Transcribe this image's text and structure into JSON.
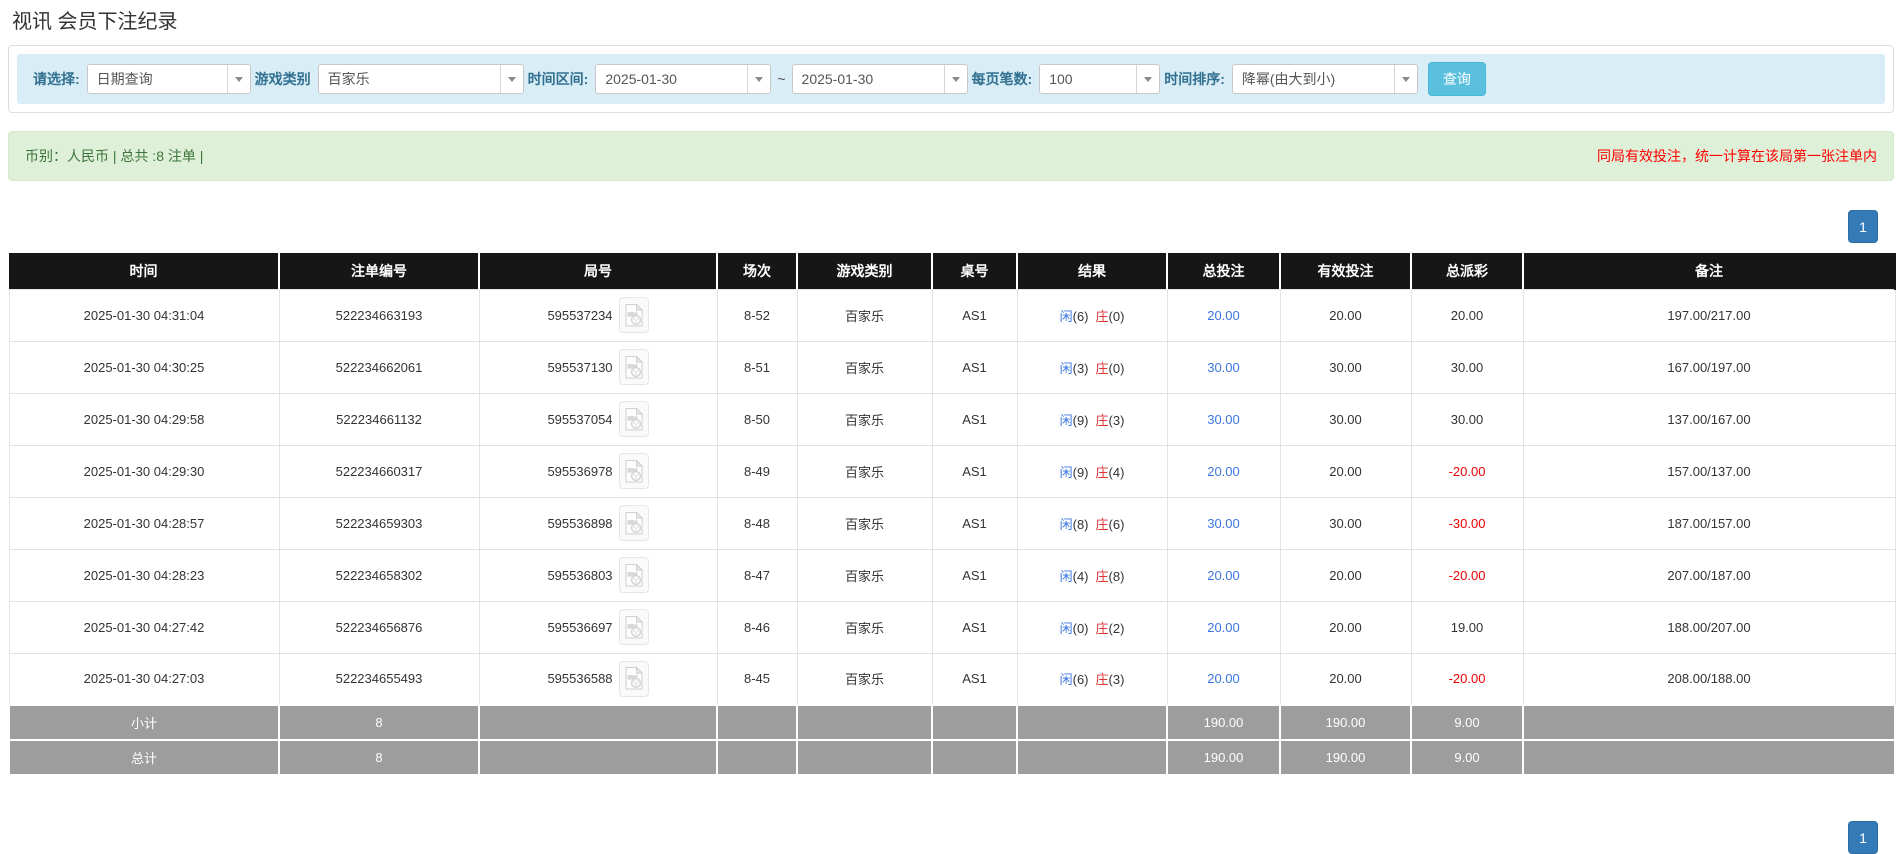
{
  "page": {
    "title": "视讯 会员下注纪录"
  },
  "filters": {
    "select_label": "请选择:",
    "select_value": "日期查询",
    "game_label": "游戏类别",
    "game_value": "百家乐",
    "range_label": "时间区间:",
    "date_from": "2025-01-30",
    "range_separator": "~",
    "date_to": "2025-01-30",
    "page_size_label": "每页笔数:",
    "page_size_value": "100",
    "sort_label": "时间排序:",
    "sort_value": "降幂(由大到小)",
    "query_button": "查询"
  },
  "summary": {
    "left": "币别：人民币 | 总共 :8 注单 |",
    "right": "同局有效投注，统一计算在该局第一张注单内"
  },
  "pagination": {
    "page": "1"
  },
  "colors": {
    "accent_blue": "#337ab7",
    "query_button": "#5bc0de",
    "filter_bg": "#d9edf7",
    "summary_bg": "#dff0d8",
    "header_bg": "#161616",
    "player_blue": "#3b76e0",
    "banker_red": "#e03333",
    "negative_red": "#f00000"
  },
  "icons": {
    "combo_caret": "caret-down-icon",
    "round_video": "video-replay-icon"
  },
  "table": {
    "headers": [
      "时间",
      "注单编号",
      "局号",
      "场次",
      "游戏类别",
      "桌号",
      "结果",
      "总投注",
      "有效投注",
      "总派彩",
      "备注"
    ],
    "rows": [
      {
        "time": "2025-01-30 04:31:04",
        "bet_id": "522234663193",
        "round_id": "595537234",
        "session": "8-52",
        "game": "百家乐",
        "table_no": "AS1",
        "p_label": "闲",
        "p_num": "(6)",
        "b_label": "庄",
        "b_num": "(0)",
        "total_bet": "20.00",
        "valid_bet": "20.00",
        "payout": "20.00",
        "remark": "197.00/217.00"
      },
      {
        "time": "2025-01-30 04:30:25",
        "bet_id": "522234662061",
        "round_id": "595537130",
        "session": "8-51",
        "game": "百家乐",
        "table_no": "AS1",
        "p_label": "闲",
        "p_num": "(3)",
        "b_label": "庄",
        "b_num": "(0)",
        "total_bet": "30.00",
        "valid_bet": "30.00",
        "payout": "30.00",
        "remark": "167.00/197.00"
      },
      {
        "time": "2025-01-30 04:29:58",
        "bet_id": "522234661132",
        "round_id": "595537054",
        "session": "8-50",
        "game": "百家乐",
        "table_no": "AS1",
        "p_label": "闲",
        "p_num": "(9)",
        "b_label": "庄",
        "b_num": "(3)",
        "total_bet": "30.00",
        "valid_bet": "30.00",
        "payout": "30.00",
        "remark": "137.00/167.00"
      },
      {
        "time": "2025-01-30 04:29:30",
        "bet_id": "522234660317",
        "round_id": "595536978",
        "session": "8-49",
        "game": "百家乐",
        "table_no": "AS1",
        "p_label": "闲",
        "p_num": "(9)",
        "b_label": "庄",
        "b_num": "(4)",
        "total_bet": "20.00",
        "valid_bet": "20.00",
        "payout": "-20.00",
        "remark": "157.00/137.00"
      },
      {
        "time": "2025-01-30 04:28:57",
        "bet_id": "522234659303",
        "round_id": "595536898",
        "session": "8-48",
        "game": "百家乐",
        "table_no": "AS1",
        "p_label": "闲",
        "p_num": "(8)",
        "b_label": "庄",
        "b_num": "(6)",
        "total_bet": "30.00",
        "valid_bet": "30.00",
        "payout": "-30.00",
        "remark": "187.00/157.00"
      },
      {
        "time": "2025-01-30 04:28:23",
        "bet_id": "522234658302",
        "round_id": "595536803",
        "session": "8-47",
        "game": "百家乐",
        "table_no": "AS1",
        "p_label": "闲",
        "p_num": "(4)",
        "b_label": "庄",
        "b_num": "(8)",
        "total_bet": "20.00",
        "valid_bet": "20.00",
        "payout": "-20.00",
        "remark": "207.00/187.00"
      },
      {
        "time": "2025-01-30 04:27:42",
        "bet_id": "522234656876",
        "round_id": "595536697",
        "session": "8-46",
        "game": "百家乐",
        "table_no": "AS1",
        "p_label": "闲",
        "p_num": "(0)",
        "b_label": "庄",
        "b_num": "(2)",
        "total_bet": "20.00",
        "valid_bet": "20.00",
        "payout": "19.00",
        "remark": "188.00/207.00"
      },
      {
        "time": "2025-01-30 04:27:03",
        "bet_id": "522234655493",
        "round_id": "595536588",
        "session": "8-45",
        "game": "百家乐",
        "table_no": "AS1",
        "p_label": "闲",
        "p_num": "(6)",
        "b_label": "庄",
        "b_num": "(3)",
        "total_bet": "20.00",
        "valid_bet": "20.00",
        "payout": "-20.00",
        "remark": "208.00/188.00"
      }
    ],
    "subtotal": {
      "label": "小计",
      "count": "8",
      "total_bet": "190.00",
      "valid_bet": "190.00",
      "payout": "9.00"
    },
    "total": {
      "label": "总计",
      "count": "8",
      "total_bet": "190.00",
      "valid_bet": "190.00",
      "payout": "9.00"
    }
  }
}
